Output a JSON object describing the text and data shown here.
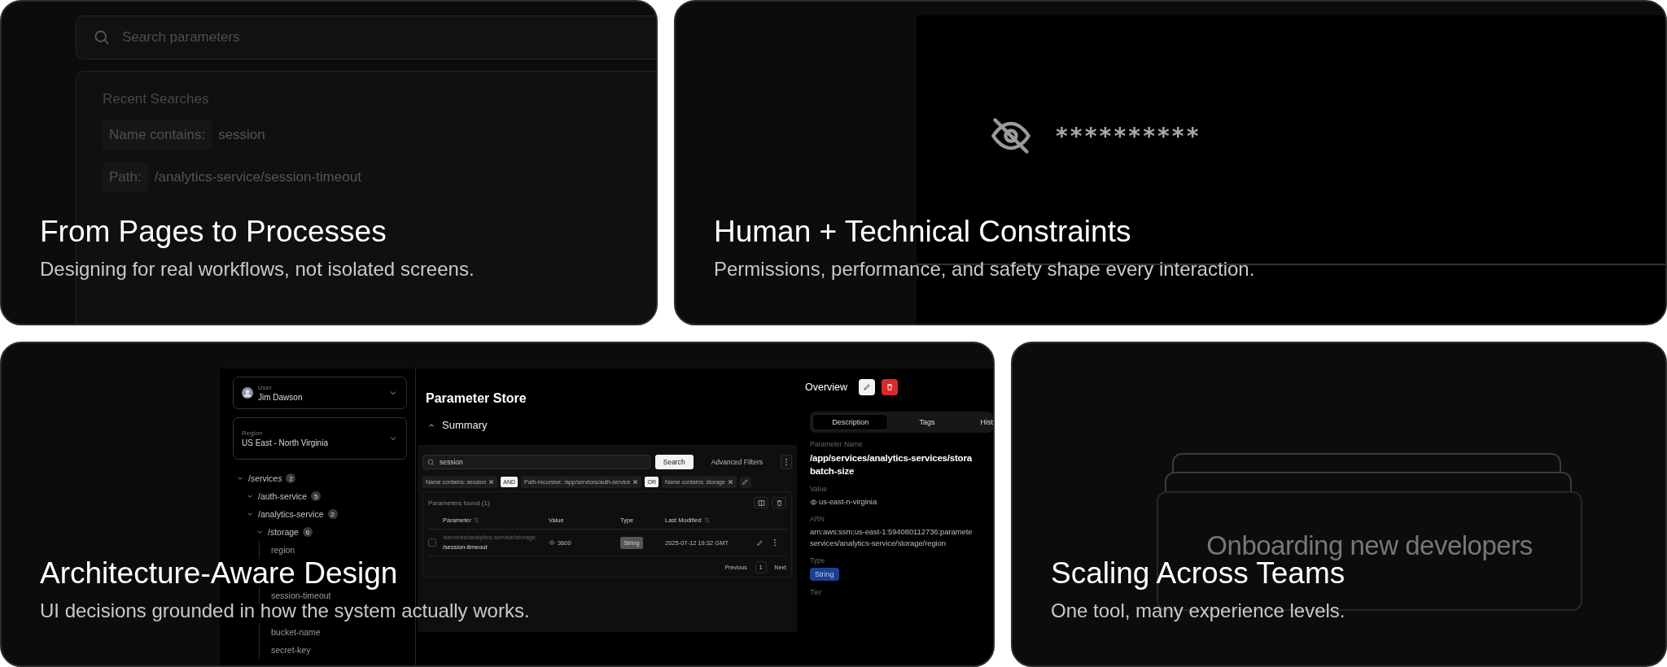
{
  "search_card": {
    "title": "From Pages to Processes",
    "subtitle": "Designing for real workflows, not isolated screens.",
    "search": {
      "placeholder": "Search parameters"
    },
    "recent": {
      "heading": "Recent Searches",
      "items": [
        {
          "label": "Name contains:",
          "value": "session"
        },
        {
          "label": "Path:",
          "value": "/analytics-service/session-timeout"
        }
      ]
    }
  },
  "secret_card": {
    "title": "Human + Technical Constraints",
    "subtitle": "Permissions, performance, and safety shape every interaction.",
    "masked_value": "**********"
  },
  "app_card": {
    "title": "Architecture-Aware Design",
    "subtitle": "UI decisions grounded in how the system actually works.",
    "sidebar": {
      "user": {
        "label": "User",
        "value": "Jim Dawson"
      },
      "region": {
        "label": "Region",
        "value": "US East - North Virginia"
      },
      "tree": [
        {
          "label": "/services",
          "count": "2",
          "expanded": true,
          "children": [
            {
              "label": "/auth-service",
              "count": "5",
              "expanded": true
            },
            {
              "label": "/analytics-service",
              "count": "2",
              "expanded": true,
              "children": [
                {
                  "label": "/storage",
                  "count": "6",
                  "expanded": true,
                  "children": [
                    {
                      "label": "region"
                    },
                    {
                      "label": "session-timeout"
                    },
                    {
                      "label": "bucket-name"
                    },
                    {
                      "label": "secret-key"
                    }
                  ]
                }
              ]
            }
          ]
        }
      ]
    },
    "main": {
      "title": "Parameter Store",
      "section": {
        "label": "Summary",
        "expanded": true
      },
      "search": {
        "value": "session"
      },
      "search_button": "Search",
      "advanced_button": "Advanced Filters",
      "filters": [
        {
          "kind": "chip",
          "label": "Name contains: session"
        },
        {
          "kind": "operator",
          "label": "AND"
        },
        {
          "kind": "chip",
          "label": "Path-recursive: /app/services/auth-service"
        },
        {
          "kind": "operator",
          "label": "OR"
        },
        {
          "kind": "chip",
          "label": "Name contains: storage"
        }
      ],
      "results": {
        "heading": "Parameters found",
        "count": "(1)",
        "columns": [
          {
            "label": "Parameter",
            "sortable": true
          },
          {
            "label": "Value",
            "sortable": false
          },
          {
            "label": "Type",
            "sortable": false
          },
          {
            "label": "Last Modified",
            "sortable": true
          }
        ],
        "rows": [
          {
            "path": "/services/analytics-service/storage",
            "name": "/session-timeout",
            "value": "3600",
            "type": "String",
            "modified": "2025-07-12 19:32 GMT",
            "selected": false
          }
        ],
        "pagination": {
          "previous": "Previous",
          "page": "1",
          "next": "Next"
        }
      }
    },
    "detail": {
      "title": "Overview",
      "tabs": [
        {
          "label": "Description",
          "selected": true
        },
        {
          "label": "Tags",
          "selected": false
        },
        {
          "label": "Hist",
          "selected": false
        }
      ],
      "fields": [
        {
          "kind": "name",
          "label": "Parameter Name",
          "lines": [
            "/app/services/analytics-services/stora",
            "batch-size"
          ]
        },
        {
          "kind": "secret",
          "label": "Value",
          "value": "us-east-n-virginia"
        },
        {
          "kind": "text",
          "label": "ARN",
          "lines": [
            "arn:aws:ssm:us-east-1:594080112736:paramete",
            "services/analytics-service/storage/region"
          ]
        },
        {
          "kind": "badge",
          "label": "Type",
          "value": "String"
        },
        {
          "kind": "label",
          "label": "Tier"
        }
      ]
    }
  },
  "teams_card": {
    "title": "Scaling Across Teams",
    "subtitle": "One tool, many experience levels.",
    "stack_label": "Onboarding new developers"
  }
}
